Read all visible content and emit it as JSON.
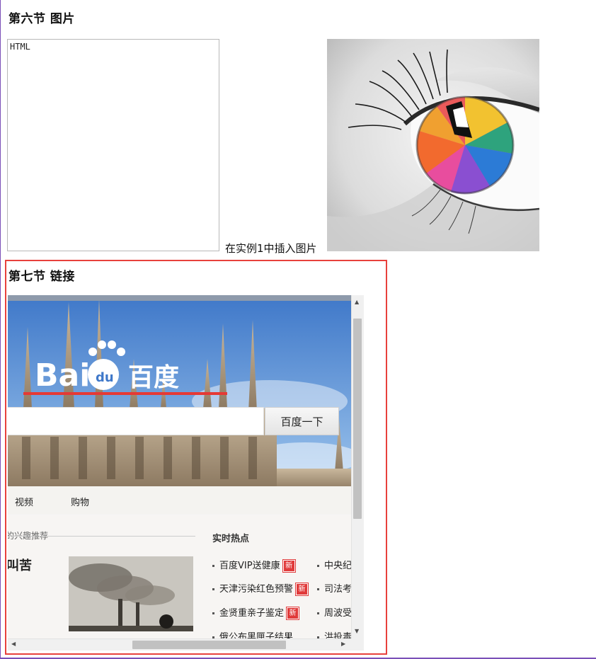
{
  "section6": {
    "heading": "第六节 图片",
    "broken_image_alt": "HTML",
    "caption": "在实例1中插入图片"
  },
  "section7": {
    "heading": "第七节 链接"
  },
  "embedded_baidu": {
    "logo_text": "Bai百度",
    "search": {
      "value": "",
      "button_label": "百度一下"
    },
    "nav": [
      "视频",
      "购物"
    ],
    "recommend_label": "的兴趣推荐",
    "news_title": "叫苦",
    "hot_title": "实时热点",
    "hot_items": [
      {
        "text": "百度VIP送健康",
        "badge": "新"
      },
      {
        "text": "天津污染红色预警",
        "badge": "新"
      },
      {
        "text": "金贤重亲子鉴定",
        "badge": "新"
      },
      {
        "text": "俄公布黑匣子结果",
        "badge": ""
      }
    ],
    "hot_items_right": [
      "中央纪",
      "司法考",
      "周波受",
      "洪投毒"
    ]
  },
  "colors": {
    "highlight_frame": "#e8413c",
    "window_border": "#7a4fb8",
    "badge": "#e03a3a"
  }
}
